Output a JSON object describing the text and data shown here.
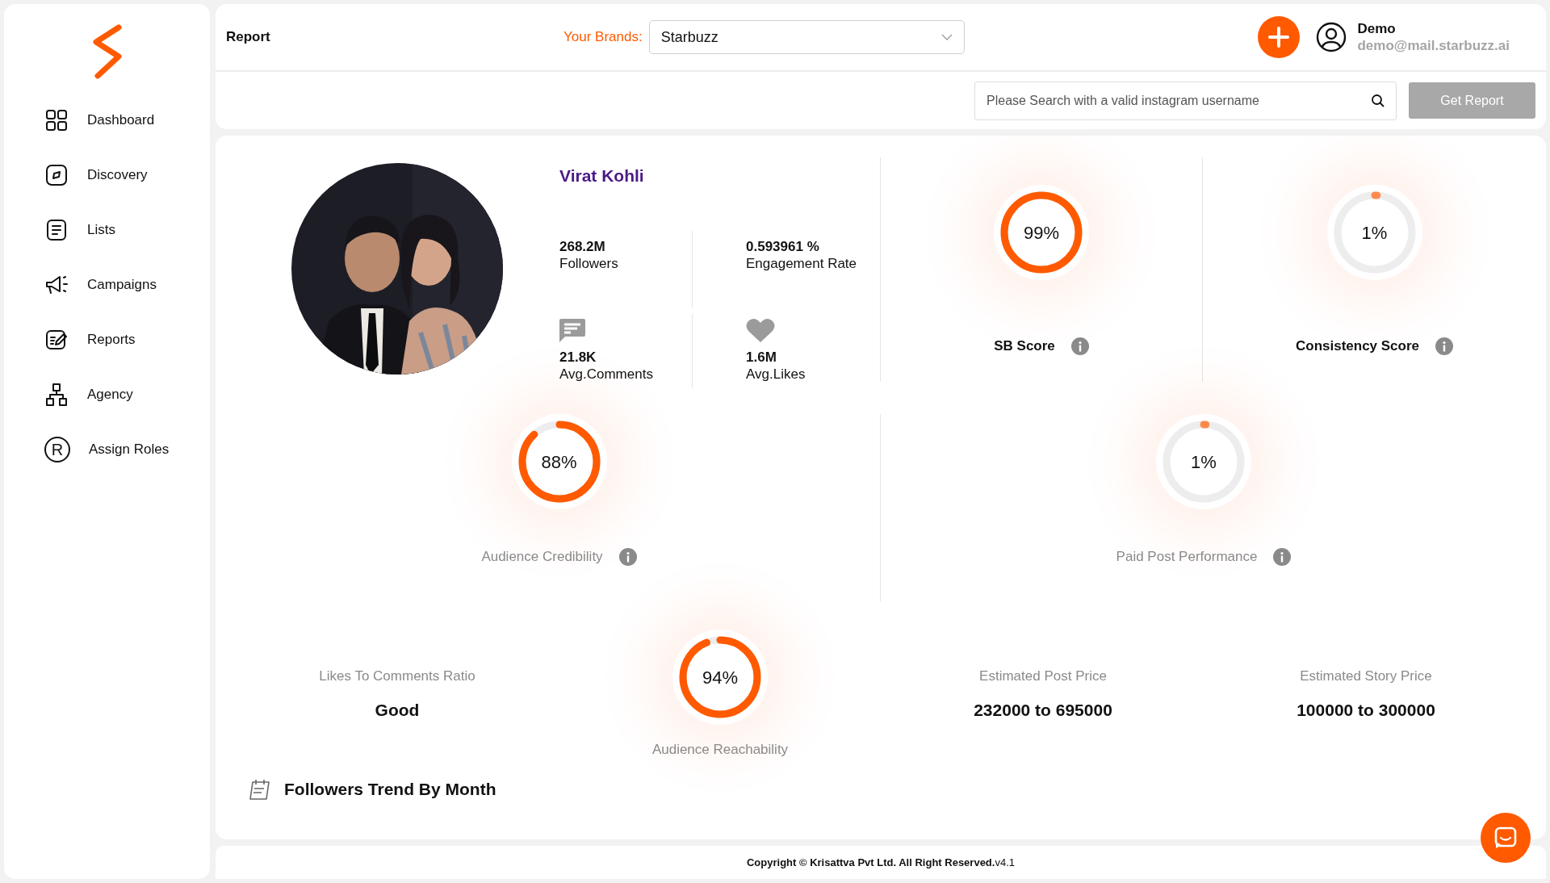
{
  "sidebar": {
    "items": [
      {
        "label": "Dashboard",
        "selected": false
      },
      {
        "label": "Discovery",
        "selected": false
      },
      {
        "label": "Lists",
        "selected": false
      },
      {
        "label": "Campaigns",
        "selected": false
      },
      {
        "label": "Reports",
        "selected": false
      },
      {
        "label": "Agency",
        "selected": false
      },
      {
        "label": "Assign Roles",
        "icon_text": "R",
        "selected": false
      }
    ]
  },
  "header": {
    "title": "Report",
    "brand_label": "Your Brands:",
    "brand_select": {
      "value": "Starbuzz"
    },
    "user": {
      "name": "Demo",
      "email": "demo@mail.starbuzz.ai"
    }
  },
  "search": {
    "placeholder": "Please Search with a valid instagram username",
    "button": {
      "label": "Get Report",
      "disabled": true
    }
  },
  "profile": {
    "name": "Virat Kohli",
    "stats": [
      {
        "value": "268.2M",
        "label": "Followers"
      },
      {
        "value": "0.593961 %",
        "label": "Engagement Rate"
      },
      {
        "value": "21.8K",
        "label": "Avg.Comments"
      },
      {
        "value": "1.6M",
        "label": "Avg.Likes"
      }
    ]
  },
  "scores": [
    {
      "value": "99%",
      "label": "SB Score",
      "kind": "headline"
    },
    {
      "value": "1%",
      "label": "Consistency Score",
      "kind": "headline"
    },
    {
      "value": "88%",
      "label": "Audience Credibility",
      "kind": "muted"
    },
    {
      "value": "1%",
      "label": "Paid Post Performance",
      "kind": "muted"
    }
  ],
  "metrics": [
    {
      "kind": "text",
      "label": "Likes To Comments Ratio",
      "value": "Good"
    },
    {
      "kind": "donut",
      "percent": "94%",
      "label": "Audience Reachability"
    },
    {
      "kind": "text",
      "label": "Estimated Post Price",
      "value": "232000 to 695000"
    },
    {
      "kind": "text",
      "label": "Estimated Story Price",
      "value": "100000 to 300000"
    }
  ],
  "section": {
    "title": "Followers Trend By Month"
  },
  "footer": {
    "text": "**Copyright © Krisattva Pvt Ltd. All Right Reserved.**v4.1"
  }
}
